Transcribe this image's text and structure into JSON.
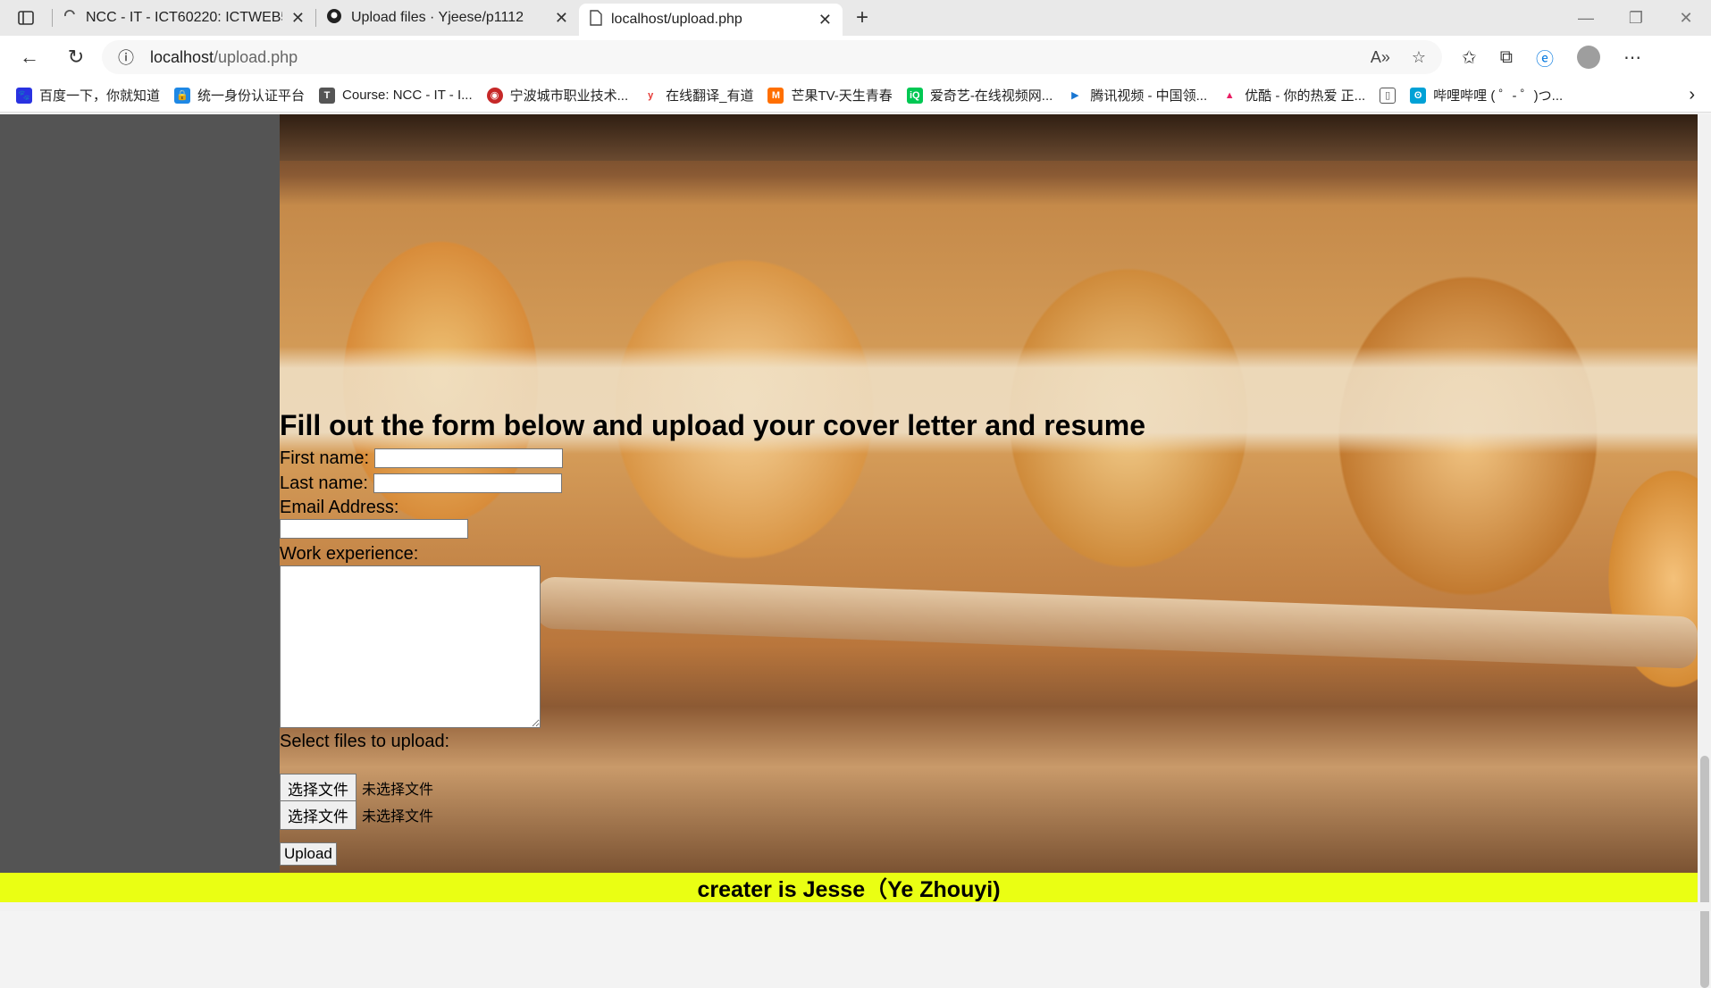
{
  "tabs": [
    {
      "title": "NCC - IT - ICT60220: ICTWEB513",
      "icon": "loading-icon"
    },
    {
      "title": "Upload files · Yjeese/p1112",
      "icon": "github-icon"
    },
    {
      "title": "localhost/upload.php",
      "icon": "page-icon"
    }
  ],
  "address": {
    "url_host": "localhost",
    "url_path": "/upload.php"
  },
  "bookmarks": [
    {
      "label": "百度一下，你就知道",
      "color": "#2932e1"
    },
    {
      "label": "统一身份认证平台",
      "color": "#1e88e5"
    },
    {
      "label": "Course: NCC - IT - I...",
      "color": "#555555"
    },
    {
      "label": "宁波城市职业技术...",
      "color": "#c62828"
    },
    {
      "label": "在线翻译_有道",
      "color": "#e53935"
    },
    {
      "label": "芒果TV-天生青春",
      "color": "#ff6f00"
    },
    {
      "label": "爱奇艺-在线视频网...",
      "color": "#00c853"
    },
    {
      "label": "腾讯视频 - 中国领...",
      "color": "#1976d2"
    },
    {
      "label": "优酷 - 你的热爱 正...",
      "color": "#e91e63"
    },
    {
      "label": "",
      "color": "#777777"
    },
    {
      "label": "哔哩哔哩 ( ゜- ゜)つ...",
      "color": "#00a1d6"
    }
  ],
  "form": {
    "heading": "Fill out the form below and upload your cover letter and resume",
    "first_name_label": "First name:",
    "last_name_label": "Last name:",
    "email_label": "Email Address:",
    "work_label": "Work experience:",
    "files_label": "Select files to upload:",
    "file_button": "选择文件",
    "file_none": "未选择文件",
    "upload_button": "Upload"
  },
  "footer": {
    "text": "creater is Jesse（Ye Zhouyi)"
  },
  "colors": {
    "footer_bg": "#eaff13",
    "sidebar_bg": "#545454"
  }
}
